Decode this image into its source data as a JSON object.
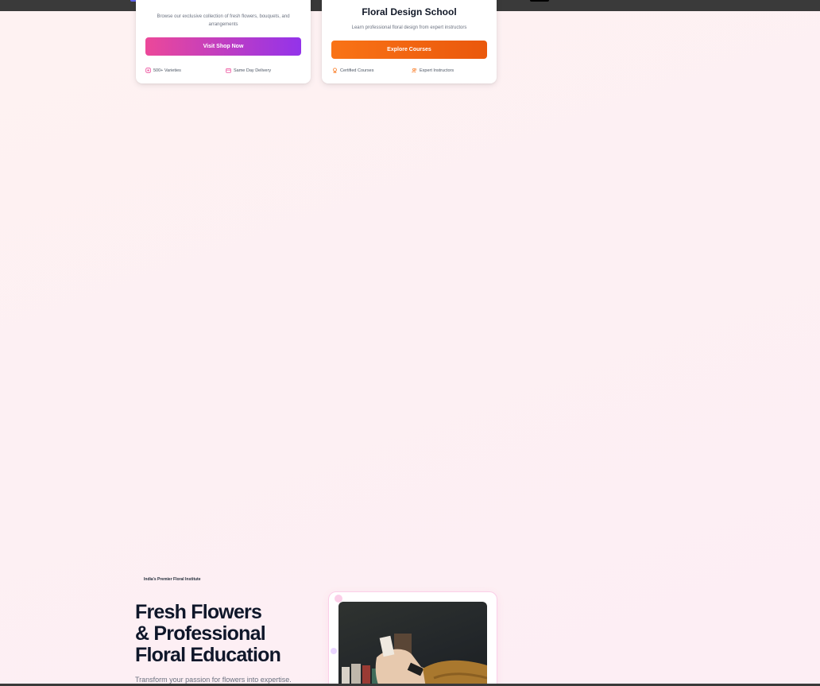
{
  "shop_card": {
    "description": "Browse our exclusive collection of fresh flowers, bouquets, and arrangements",
    "button_label": "Visit Shop Now",
    "features": [
      {
        "label": "500+ Varieties",
        "icon": "flower-icon"
      },
      {
        "label": "Same Day Delivery",
        "icon": "calendar-icon"
      }
    ],
    "accent_from": "#ec4899",
    "accent_to": "#9333ea"
  },
  "school_card": {
    "title": "Floral Design School",
    "description": "Learn professional floral design from expert instructors",
    "button_label": "Explore Courses",
    "features": [
      {
        "label": "Certified Courses",
        "icon": "award-icon"
      },
      {
        "label": "Expert Instructors",
        "icon": "users-icon"
      }
    ],
    "accent_from": "#f97316",
    "accent_to": "#ea580c"
  },
  "hero": {
    "badge": "India's Premier Floral Institute",
    "title_line1": "Fresh Flowers",
    "title_line2": "& Professional",
    "title_line3": "Floral Education",
    "subtitle": "Transform your passion for flowers into expertise."
  }
}
